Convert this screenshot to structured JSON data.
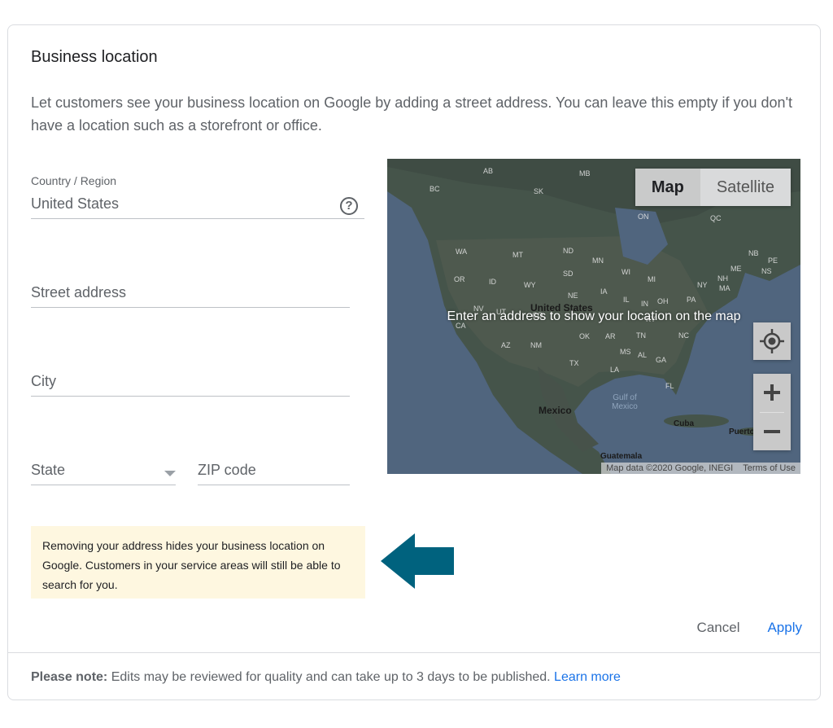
{
  "dialog": {
    "title": "Business location",
    "description": "Let customers see your business location on Google by adding a street address. You can leave this empty if you don't have a location such as a storefront or office."
  },
  "form": {
    "country_label": "Country / Region",
    "country_value": "United States",
    "help_icon": "help-circle-icon",
    "street_placeholder": "Street address",
    "city_placeholder": "City",
    "state_placeholder": "State",
    "zip_placeholder": "ZIP code"
  },
  "notice": {
    "text": "Removing your address hides your business location on Google. Customers in your service areas will still be able to search for you.",
    "background": "#fef7e0"
  },
  "arrow": {
    "icon": "left-arrow-icon",
    "color": "#00627e"
  },
  "map": {
    "overlay_text": "Enter an address to show your location on the map",
    "toggle": [
      "Map",
      "Satellite"
    ],
    "active_toggle": "Map",
    "locate_icon": "my-location-icon",
    "zoom_in_icon": "plus-icon",
    "zoom_out_icon": "minus-icon",
    "attribution": "Map data ©2020 Google, INEGI",
    "terms": "Terms of Use",
    "labels": {
      "ab": "AB",
      "mb": "MB",
      "bc": "BC",
      "sk": "SK",
      "on": "ON",
      "qc": "QC",
      "wa": "WA",
      "mt": "MT",
      "nd": "ND",
      "mn": "MN",
      "sd": "SD",
      "or": "OR",
      "id": "ID",
      "wy": "WY",
      "ne": "NE",
      "ia": "IA",
      "wi": "WI",
      "mi": "MI",
      "nv": "NV",
      "ut": "UT",
      "co": "CO",
      "ca": "CA",
      "az": "AZ",
      "nm": "NM",
      "ok": "OK",
      "ar": "AR",
      "tx": "TX",
      "la": "LA",
      "ms": "MS",
      "al": "AL",
      "ga": "GA",
      "tn": "TN",
      "ky": "KY",
      "in": "IN",
      "oh": "OH",
      "il": "IL",
      "pa": "PA",
      "ny": "NY",
      "nc": "NC",
      "fl": "FL",
      "me": "ME",
      "nh": "NH",
      "nb": "NB",
      "pe": "PE",
      "ns": "NS",
      "ma": "MA",
      "us": "United States",
      "mexico": "Mexico",
      "gulf": "Gulf of Mexico",
      "cuba": "Cuba",
      "guatemala": "Guatemala",
      "puerto": "Puerto"
    }
  },
  "actions": {
    "cancel": "Cancel",
    "apply": "Apply"
  },
  "footer": {
    "bold": "Please note:",
    "text": " Edits may be reviewed for quality and can take up to 3 days to be published.",
    "link": "Learn more"
  }
}
